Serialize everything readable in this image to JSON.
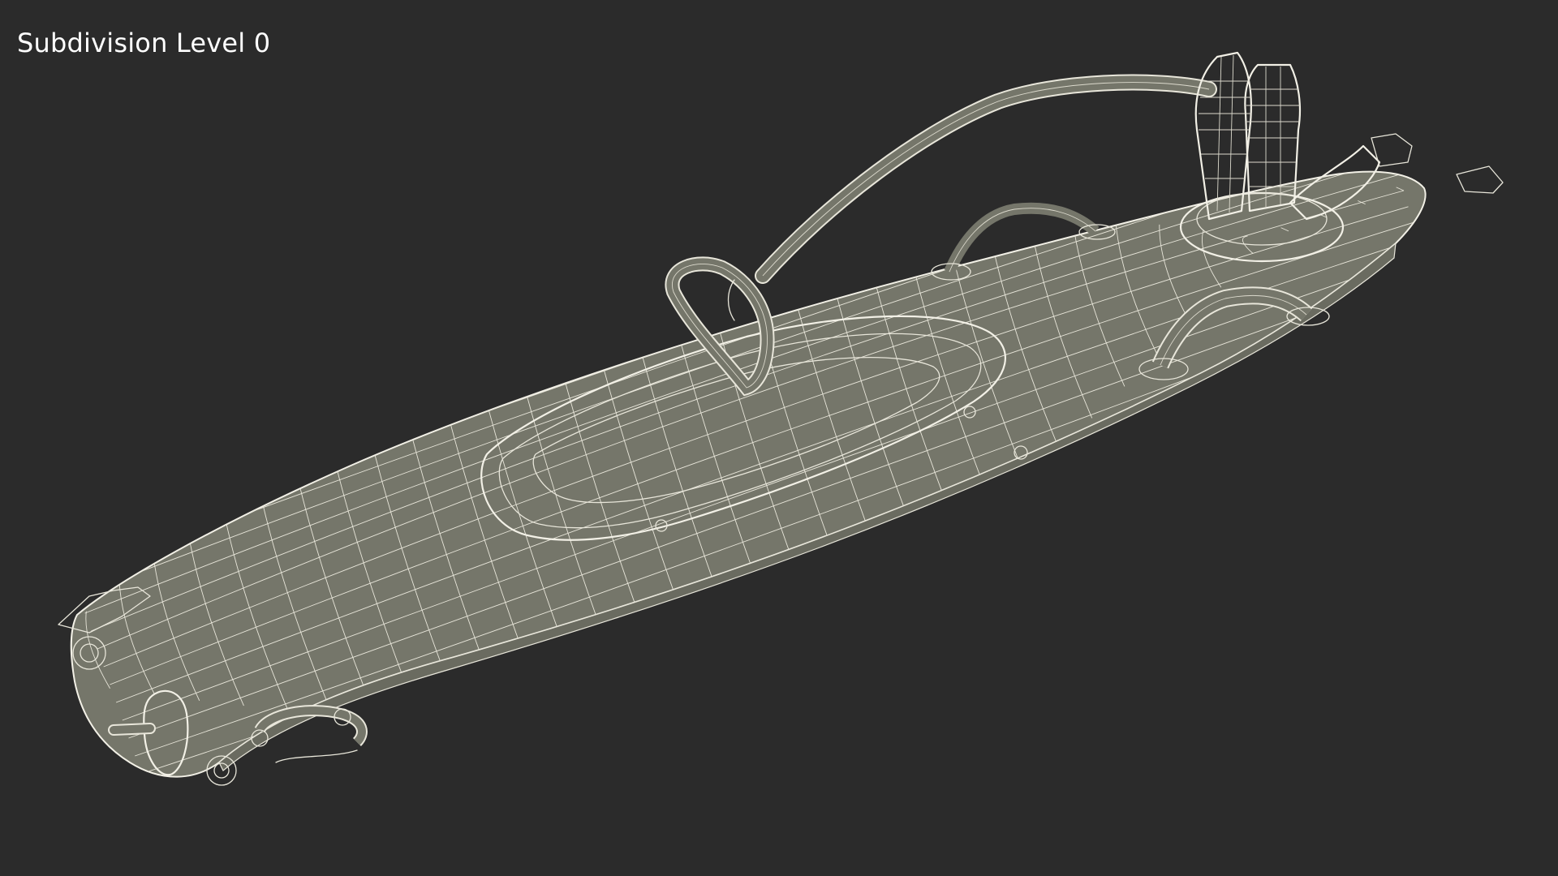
{
  "viewport": {
    "label": "Subdivision Level 0",
    "background_color": "#2b2b2b",
    "mesh_fill_color": "#75766a",
    "wire_color": "#e8e6da"
  }
}
